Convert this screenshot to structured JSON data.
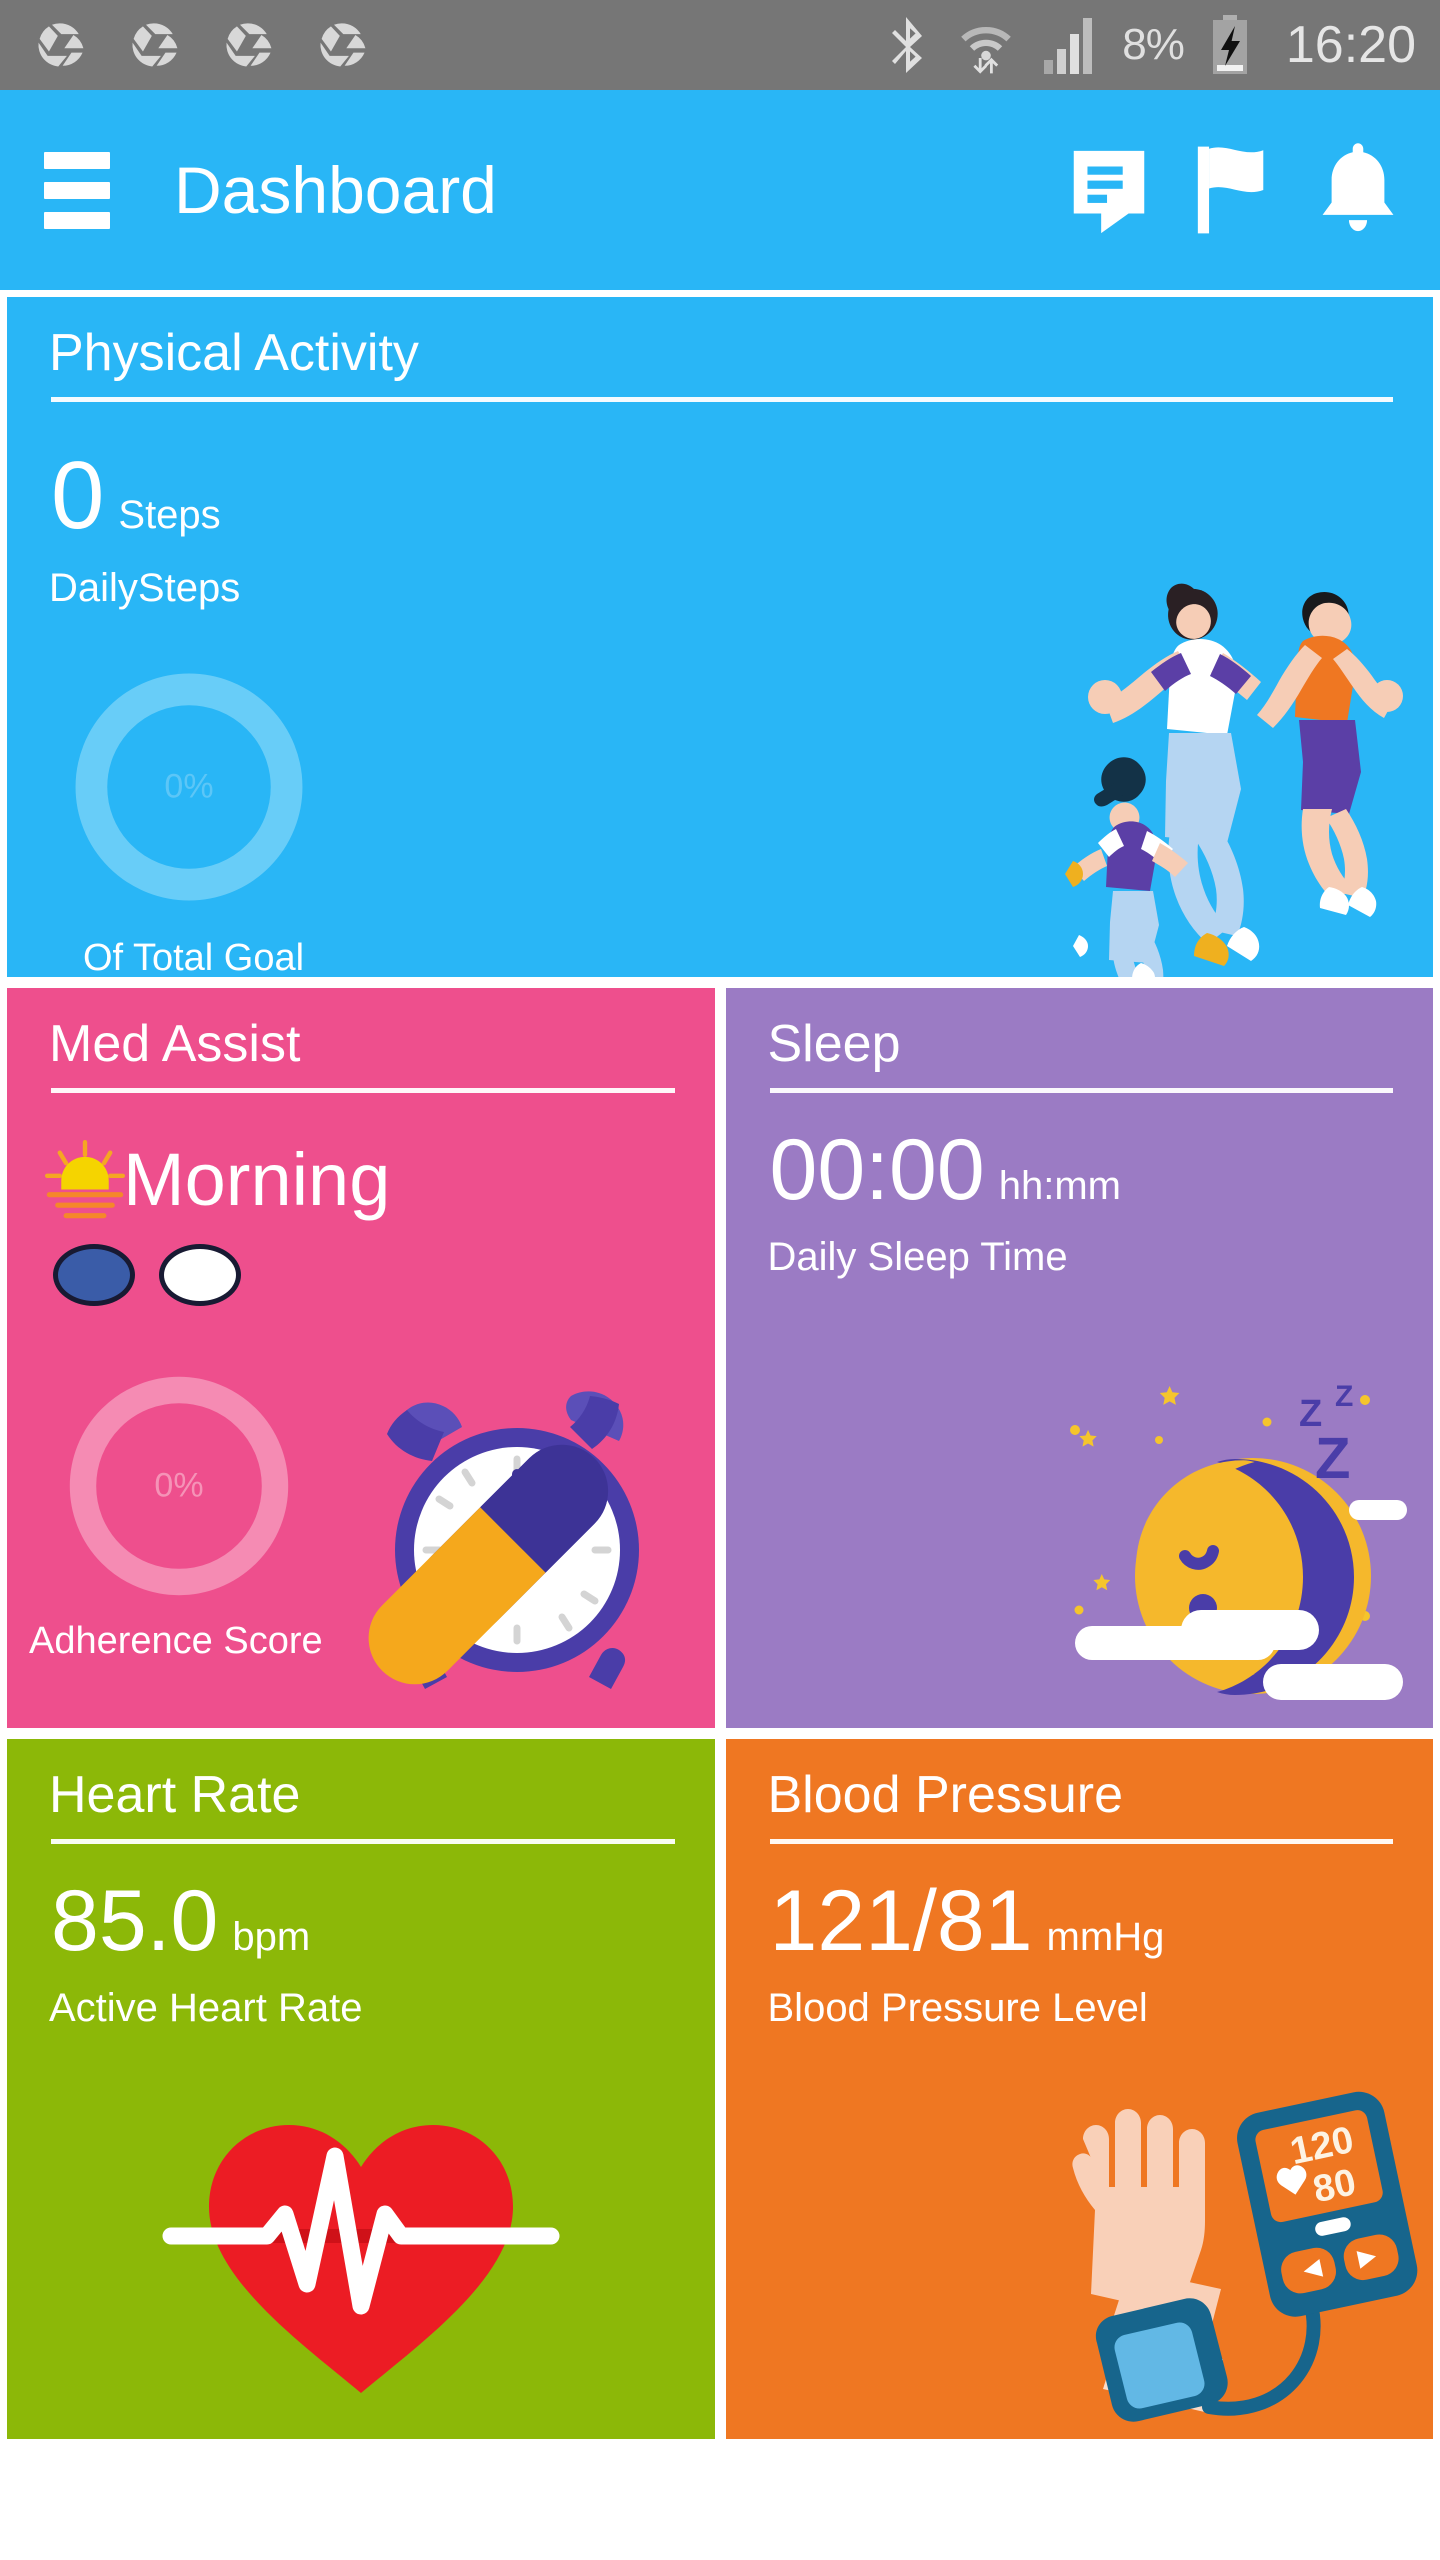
{
  "status_bar": {
    "notification_icons": [
      "aperture-icon",
      "aperture-icon",
      "aperture-icon",
      "aperture-icon"
    ],
    "bluetooth_icon": "bluetooth-icon",
    "wifi_icon": "wifi-data-icon",
    "signal_icon": "cellular-signal-icon",
    "battery_percent": "8%",
    "battery_icon": "battery-charging-icon",
    "clock": "16:20",
    "background": "#767676"
  },
  "app_bar": {
    "menu_icon": "hamburger-menu-icon",
    "title": "Dashboard",
    "actions": [
      {
        "icon": "message-icon",
        "name": "messages-button"
      },
      {
        "icon": "flag-icon",
        "name": "flag-button"
      },
      {
        "icon": "bell-icon",
        "name": "notifications-button"
      }
    ],
    "background": "#29b6f6"
  },
  "cards": {
    "physical_activity": {
      "title": "Physical Activity",
      "value": "0",
      "unit": "Steps",
      "caption": "DailySteps",
      "ring_percent": "0%",
      "ring_caption": "Of Total Goal",
      "illustration": "family-running-illustration",
      "background": "#29b6f6"
    },
    "med_assist": {
      "title": "Med Assist",
      "time_of_day_icon": "sunrise-icon",
      "time_of_day": "Morning",
      "pills": [
        {
          "name": "pill-dose-blue",
          "color": "#3a5ca8"
        },
        {
          "name": "pill-dose-white",
          "color": "#ffffff"
        }
      ],
      "ring_percent": "0%",
      "ring_caption": "Adherence Score",
      "illustration": "alarm-clock-capsule-illustration",
      "background": "#ee4f8d"
    },
    "sleep": {
      "title": "Sleep",
      "value": "00:00",
      "unit": "hh:mm",
      "caption": "Daily Sleep Time",
      "illustration": "sleeping-moon-illustration",
      "zzz_text": "Z",
      "background": "#9b7bc4"
    },
    "heart_rate": {
      "title": "Heart Rate",
      "value": "85.0",
      "unit": "bpm",
      "caption": "Active Heart Rate",
      "illustration": "heart-ecg-illustration",
      "background": "#8cb808"
    },
    "blood_pressure": {
      "title": "Blood Pressure",
      "value": "121/81",
      "unit": "mmHg",
      "caption": "Blood Pressure Level",
      "illustration": "blood-pressure-monitor-illustration",
      "monitor_systolic": "120",
      "monitor_diastolic": "80",
      "background": "#ef7722"
    }
  }
}
